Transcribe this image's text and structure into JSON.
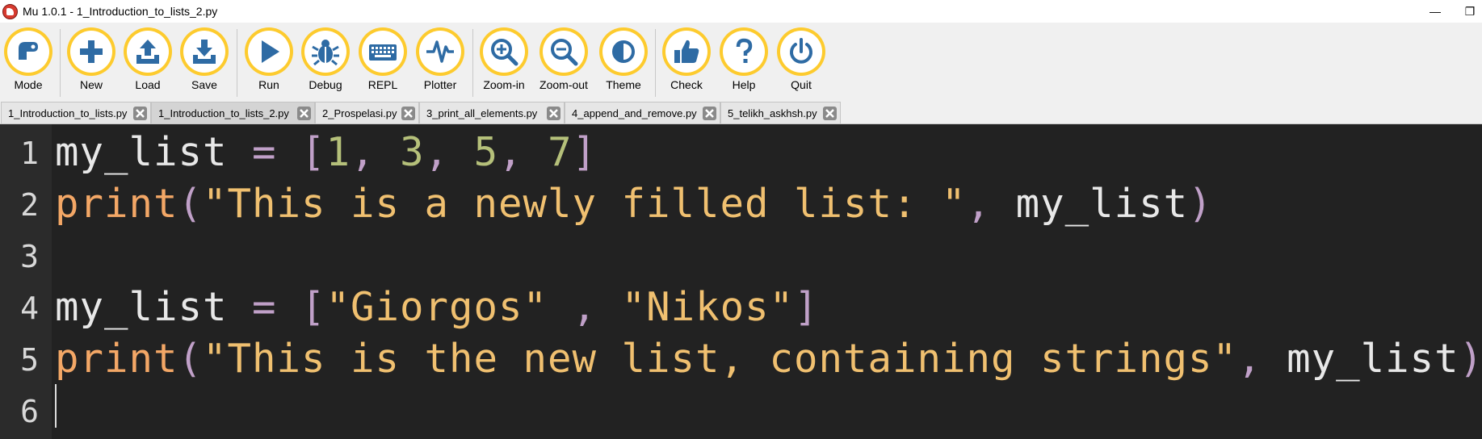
{
  "window": {
    "title": "Mu 1.0.1 - 1_Introduction_to_lists_2.py",
    "minimize": "—",
    "restore": "❐"
  },
  "toolbar": {
    "buttons": [
      {
        "label": "Mode",
        "icon": "mode-icon"
      },
      {
        "label": "New",
        "icon": "plus-icon"
      },
      {
        "label": "Load",
        "icon": "upload-icon"
      },
      {
        "label": "Save",
        "icon": "download-icon"
      },
      {
        "label": "Run",
        "icon": "play-icon"
      },
      {
        "label": "Debug",
        "icon": "bug-icon"
      },
      {
        "label": "REPL",
        "icon": "keyboard-icon"
      },
      {
        "label": "Plotter",
        "icon": "pulse-icon"
      },
      {
        "label": "Zoom-in",
        "icon": "zoom-in-icon"
      },
      {
        "label": "Zoom-out",
        "icon": "zoom-out-icon"
      },
      {
        "label": "Theme",
        "icon": "contrast-icon"
      },
      {
        "label": "Check",
        "icon": "thumbs-up-icon"
      },
      {
        "label": "Help",
        "icon": "question-icon"
      },
      {
        "label": "Quit",
        "icon": "power-icon"
      }
    ]
  },
  "tabs": [
    {
      "label": "1_Introduction_to_lists.py",
      "active": false
    },
    {
      "label": "1_Introduction_to_lists_2.py",
      "active": true
    },
    {
      "label": "2_Prospelasi.py",
      "active": false
    },
    {
      "label": "3_print_all_elements.py",
      "active": false
    },
    {
      "label": "4_append_and_remove.py",
      "active": false
    },
    {
      "label": "5_telikh_askhsh.py",
      "active": false
    }
  ],
  "editor": {
    "line_numbers": [
      "1",
      "2",
      "3",
      "4",
      "5",
      "6"
    ],
    "lines": [
      [
        {
          "t": "my_list",
          "c": "var"
        },
        {
          "t": " = ",
          "c": "op"
        },
        {
          "t": "[",
          "c": "op"
        },
        {
          "t": "1",
          "c": "num"
        },
        {
          "t": ", ",
          "c": "op"
        },
        {
          "t": "3",
          "c": "num"
        },
        {
          "t": ", ",
          "c": "op"
        },
        {
          "t": "5",
          "c": "num"
        },
        {
          "t": ", ",
          "c": "op"
        },
        {
          "t": "7",
          "c": "num"
        },
        {
          "t": "]",
          "c": "op"
        }
      ],
      [
        {
          "t": "print",
          "c": "fn"
        },
        {
          "t": "(",
          "c": "op"
        },
        {
          "t": "\"This is a newly filled list: \"",
          "c": "str"
        },
        {
          "t": ", ",
          "c": "op"
        },
        {
          "t": "my_list",
          "c": "var"
        },
        {
          "t": ")",
          "c": "op"
        }
      ],
      [],
      [
        {
          "t": "my_list",
          "c": "var"
        },
        {
          "t": " = ",
          "c": "op"
        },
        {
          "t": "[",
          "c": "op"
        },
        {
          "t": "\"Giorgos\"",
          "c": "str"
        },
        {
          "t": " , ",
          "c": "op"
        },
        {
          "t": "\"Nikos\"",
          "c": "str"
        },
        {
          "t": "]",
          "c": "op"
        }
      ],
      [
        {
          "t": "print",
          "c": "fn"
        },
        {
          "t": "(",
          "c": "op"
        },
        {
          "t": "\"This is the new list, containing strings\"",
          "c": "str"
        },
        {
          "t": ", ",
          "c": "op"
        },
        {
          "t": "my_list",
          "c": "var"
        },
        {
          "t": ")",
          "c": "op"
        }
      ],
      []
    ]
  },
  "colors": {
    "accent_ring": "#fdcb2e",
    "icon_blue": "#2e6ba4",
    "editor_bg": "#222222"
  }
}
